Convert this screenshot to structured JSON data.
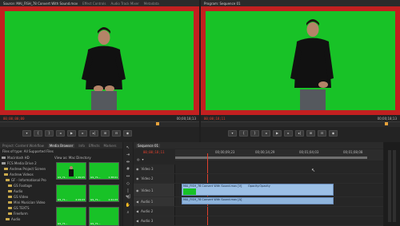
{
  "source_monitor": {
    "tabs": [
      "Source: MAI_FISH_78 Convert With Sound.mov",
      "Effect Controls",
      "Audio Track Mixer",
      "Metadata"
    ],
    "timecode_in": "00;00;00;00",
    "timecode_out": "00;00;18;13"
  },
  "program_monitor": {
    "tabs": [
      "Program: Sequence 01"
    ],
    "timecode_in": "00;00;18;11",
    "timecode_out": "00;00;18;13"
  },
  "transport_icons": [
    "mark-in-icon",
    "mark-out-icon",
    "go-to-in-icon",
    "step-back-icon",
    "play-icon",
    "step-forward-icon",
    "go-to-out-icon",
    "insert-icon",
    "overwrite-icon",
    "export-frame-icon"
  ],
  "project_panel": {
    "tabs": [
      "Project: Content Workflow",
      "Media Browser",
      "Info",
      "Effects",
      "Markers"
    ],
    "left_tree": [
      "Macintosh HD",
      "FCS Media Drive 2",
      "Andrew Project Screen",
      "Andrew Videos",
      "GF - Informational Pro",
      "GS Footage",
      "Audio",
      "GS Video",
      "Mini Musician Video",
      "GS TEXTS",
      "Freeform",
      "Audio"
    ],
    "filter_label": "Files of type: All Supported Files",
    "view_label": "View as: Mac Directory",
    "thumbs": [
      {
        "label": "GS_71...",
        "time": "1:49:05"
      },
      {
        "label": "GS_71...",
        "time": "1:38:01"
      },
      {
        "label": "GS_71...",
        "time": "2:29:23"
      },
      {
        "label": "GS_71...",
        "time": "1:41:23"
      },
      {
        "label": "GS_71...",
        "time": ""
      },
      {
        "label": "GS_71...",
        "time": ""
      }
    ]
  },
  "timeline": {
    "tab": "Sequence 01",
    "timecode": "00;00;18;11",
    "ruler_labels": [
      "00;00;09;23",
      "00;00;14;29",
      "00;01;04;03",
      "00;01;08;08"
    ],
    "tracks": [
      {
        "name": "Video 3",
        "kind": "video"
      },
      {
        "name": "Video 2",
        "kind": "video"
      },
      {
        "name": "Video 1",
        "kind": "video"
      },
      {
        "name": "Audio 1",
        "kind": "audio"
      },
      {
        "name": "Audio 2",
        "kind": "audio"
      },
      {
        "name": "Audio 3",
        "kind": "audio"
      }
    ],
    "clips": {
      "video": "MAI_FISH_78 Convert With Sound.mov [V]",
      "video_effect": "Opacity:Opacity",
      "audio": "MAI_FISH_78 Convert With Sound.mov [A]"
    }
  },
  "colors": {
    "greenscreen": "#18c227",
    "record_red": "#c32020",
    "timecode": "#e0412e",
    "clip_blue": "#9cc0e6"
  }
}
